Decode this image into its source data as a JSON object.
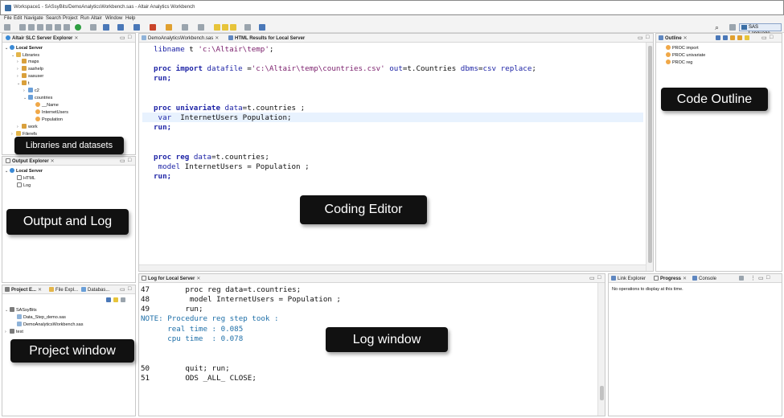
{
  "window": {
    "title": "Workspace1 - SASsyBits/DemoAnalyticsWorkbench.sas - Altair Analytics Workbench"
  },
  "menu": [
    "File",
    "Edit",
    "Navigate",
    "Search",
    "Project",
    "Run",
    "Altair",
    "Window",
    "Help"
  ],
  "toolbar": {
    "perspective_label": "SAS Language",
    "search_icon": "search-icon"
  },
  "server_explorer": {
    "tab": "Altair SLC Server Explorer",
    "server": "Local Server",
    "libraries_label": "Libraries",
    "libraries": [
      "maps",
      "sashelp",
      "sasuser",
      "t"
    ],
    "t_children": [
      "c2",
      "countries"
    ],
    "columns": [
      "__Name",
      "InternetUsers",
      "Population"
    ],
    "work": "work",
    "filerefs": "Filerefs"
  },
  "output_explorer": {
    "tab": "Output Explorer",
    "server": "Local Server",
    "items": [
      "HTML",
      "Log"
    ]
  },
  "project": {
    "tabs": [
      "Project E...",
      "File Expl...",
      "Databas..."
    ],
    "root": "SASsyBits",
    "files": [
      "Data_Step_demo.sas",
      "DemoAnalyticsWorkbench.sas"
    ],
    "other": "test"
  },
  "editor": {
    "tabs": [
      "DemoAnalyticsWorkbench.sas",
      "HTML Results for Local Server"
    ],
    "lines": [
      "libname t 'c:\\Altair\\temp';",
      "",
      "proc import datafile ='c:\\Altair\\temp\\countries.csv' out=t.Countries dbms=csv replace;",
      "run;",
      "",
      "",
      "proc univariate data=t.countries ;",
      " var  InternetUsers Population;",
      "run;",
      "",
      "",
      "proc reg data=t.countries;",
      " model InternetUsers = Population ;",
      "run;"
    ]
  },
  "outline": {
    "tab": "Outline",
    "items": [
      "PROC import",
      "PROC univariate",
      "PROC reg"
    ]
  },
  "log": {
    "tab": "Log for Local Server",
    "lines": [
      {
        "num": "47",
        "text": "proc reg data=t.countries;"
      },
      {
        "num": "48",
        "text": " model InternetUsers = Population ;"
      },
      {
        "num": "49",
        "text": "run;"
      },
      {
        "num": "",
        "text": "NOTE: Procedure reg step took :"
      },
      {
        "num": "",
        "text": "      real time : 0.085"
      },
      {
        "num": "",
        "text": "      cpu time  : 0.078"
      },
      {
        "num": "50",
        "text": "quit; run;"
      },
      {
        "num": "51",
        "text": "ODS _ALL_ CLOSE;"
      }
    ]
  },
  "bottom_right": {
    "tabs": [
      "Link Explorer",
      "Progress",
      "Console"
    ],
    "message": "No operations to display at this time."
  },
  "callouts": {
    "libraries": "Libraries and datasets",
    "output": "Output and Log",
    "project": "Project window",
    "editor": "Coding Editor",
    "outline": "Code Outline",
    "log": "Log window"
  }
}
